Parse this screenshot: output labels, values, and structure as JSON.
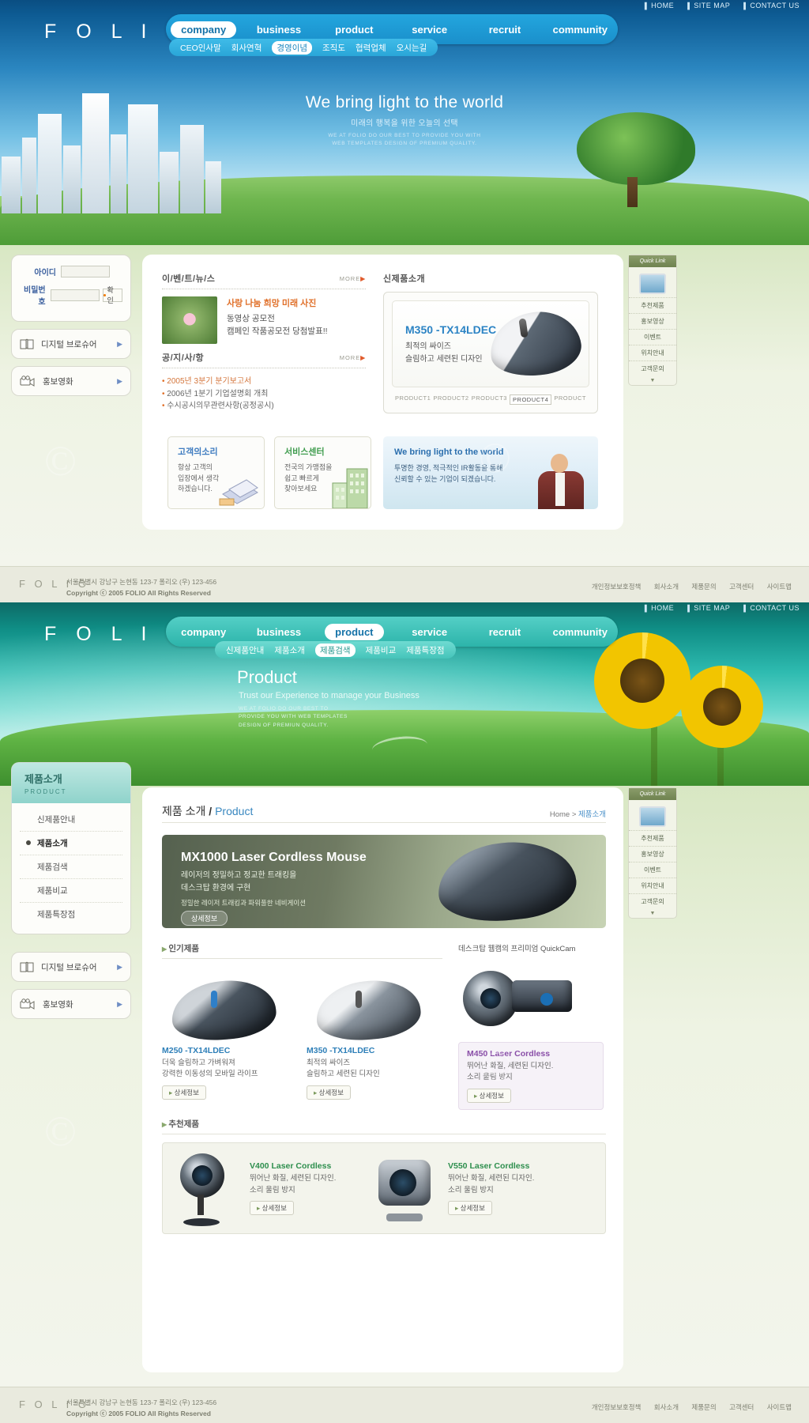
{
  "brand": {
    "logo": "F O L I O"
  },
  "top_links": [
    "HOME",
    "SITE MAP",
    "CONTACT US"
  ],
  "page1": {
    "nav": [
      {
        "label": "company",
        "active": true
      },
      {
        "label": "business",
        "active": false
      },
      {
        "label": "product",
        "active": false
      },
      {
        "label": "service",
        "active": false
      },
      {
        "label": "recruit",
        "active": false
      },
      {
        "label": "community",
        "active": false
      }
    ],
    "subnav": [
      {
        "label": "CEO인사말",
        "active": false
      },
      {
        "label": "회사연혁",
        "active": false
      },
      {
        "label": "경영이념",
        "active": true
      },
      {
        "label": "조직도",
        "active": false
      },
      {
        "label": "협력업체",
        "active": false
      },
      {
        "label": "오시는길",
        "active": false
      }
    ],
    "hero": {
      "title": "We bring light to the world",
      "subtitle": "미래의 행복을 위한 오늘의 선택",
      "body": "WE AT FOLIO DO OUR BEST TO PROVIDE YOU WITH\nWEB TEMPLATES DESIGN OF PREMIUM QUALITY."
    },
    "login": {
      "id_label": "아이디",
      "pw_label": "비밀번호",
      "id_value": "",
      "pw_value": "",
      "submit": "확 인"
    },
    "side_buttons": [
      {
        "label": "디지털 브로슈어",
        "icon": "book-icon"
      },
      {
        "label": "홍보영화",
        "icon": "video-camera-icon"
      }
    ],
    "events": {
      "title": "이/벤/트/뉴/스",
      "more": "MORE",
      "headline": "사랑 나눔 희망 미래 사진",
      "lines": [
        "동영상 공모전",
        "캠페인 작품공모전 당첨발표!!"
      ]
    },
    "notice": {
      "title": "공/지/사/항",
      "more": "MORE",
      "items": [
        {
          "text": "2005년 3분기 분기보고서",
          "highlight": true
        },
        {
          "text": "2006년 1분기 기업설명회 개최",
          "highlight": false
        },
        {
          "text": "수시공시의무관련사항(공정공시)",
          "highlight": false
        }
      ]
    },
    "new_product": {
      "title": "신제품소개",
      "name": "M350 -TX14LDEC",
      "lines": [
        "최적의 싸이즈",
        "슬림하고 세련된 디자인"
      ],
      "tabs": [
        {
          "label": "PRODUCT1",
          "active": false
        },
        {
          "label": "PRODUCT2",
          "active": false
        },
        {
          "label": "PRODUCT3",
          "active": false
        },
        {
          "label": "PRODUCT4",
          "active": true
        },
        {
          "label": "PRODUCT",
          "active": false
        }
      ]
    },
    "voice_box": {
      "title": "고객의소리",
      "text": "항상 고객의\n입장에서 생각\n하겠습니다."
    },
    "service_box": {
      "title": "서비스센터",
      "text": "전국의 가맹점을\n쉽고 빠르게\n찾아보세요"
    },
    "blue_banner": {
      "title": "We bring light to the world",
      "text": "투명한 경영, 적극적인 IR활동을 통해\n신뢰할 수 있는 기업이 되겠습니다."
    }
  },
  "quick_link": {
    "title": "Quick Link",
    "items": [
      "추천제품",
      "홍보영상",
      "이벤트",
      "위치안내",
      "고객문의"
    ],
    "more": "▼"
  },
  "footer": {
    "logo": "F O L I O",
    "address": "서울특별시 강남구 논현동 123-7 폴리오  (우) 123-456",
    "copyright": "Copyright ⓒ 2005 FOLIO All Rights Reserved",
    "links": [
      "개인정보보호정책",
      "회사소개",
      "제품문의",
      "고객센터",
      "사이트맵"
    ]
  },
  "page2": {
    "nav": [
      {
        "label": "company",
        "active": false
      },
      {
        "label": "business",
        "active": false
      },
      {
        "label": "product",
        "active": true
      },
      {
        "label": "service",
        "active": false
      },
      {
        "label": "recruit",
        "active": false
      },
      {
        "label": "community",
        "active": false
      }
    ],
    "subnav": [
      {
        "label": "신제품안내",
        "active": false
      },
      {
        "label": "제품소개",
        "active": false
      },
      {
        "label": "제품검색",
        "active": true
      },
      {
        "label": "제품비교",
        "active": false
      },
      {
        "label": "제품특장점",
        "active": false
      }
    ],
    "hero": {
      "title": "Product",
      "subtitle": "Trust our Experience to manage your Business",
      "body": "WE AT FOLIO DO OUR BEST TO\nPROVIDE YOU WITH WEB TEMPLATES\nDESIGN OF PREMIUN QUALITY."
    },
    "sidenav": {
      "kr": "제품소개",
      "en": "PRODUCT",
      "items": [
        {
          "label": "신제품안내",
          "active": false
        },
        {
          "label": "제품소개",
          "active": true
        },
        {
          "label": "제품검색",
          "active": false
        },
        {
          "label": "제품비교",
          "active": false
        },
        {
          "label": "제품특장점",
          "active": false
        }
      ]
    },
    "side_buttons": [
      {
        "label": "디지털 브로슈어",
        "icon": "book-icon"
      },
      {
        "label": "홍보영화",
        "icon": "video-camera-icon"
      }
    ],
    "page_title_kr": "제품 소개",
    "page_title_en": "Product",
    "breadcrumb": "Home",
    "breadcrumb_current": "제품소개",
    "promo": {
      "title": "MX1000 Laser Cordless Mouse",
      "lines": [
        "레이저의 정밀하고 정교한 트래킹을",
        "데스크탑 환경에 구현"
      ],
      "small": "정밀한 레이저 트래킹과 파워풀한 네비게이션",
      "button": "상세정보"
    },
    "popular_title": "인기제품",
    "popular": [
      {
        "name": "M250 -TX14LDEC",
        "desc": "더욱 슬림하고 가벼워져\n강력한 이동성의 모바일 라이프",
        "button": "상세정보"
      },
      {
        "name": "M350 -TX14LDEC",
        "desc": "최적의 싸이즈\n슬림하고 세련된 디자인",
        "button": "상세정보"
      }
    ],
    "quickcam": {
      "caption": "데스크탑 웹캠의 프리미엄  QuickCam",
      "name": "M450 Laser Cordless",
      "desc": "뛰어난 화질, 세련된 디자인.\n소리 울림 방지",
      "button": "상세정보"
    },
    "recommend_title": "추천제품",
    "recommend": [
      {
        "name": "V400 Laser Cordless",
        "desc": "뛰어난 화질, 세련된 디자인.\n소리 울림 방지",
        "button": "상세정보"
      },
      {
        "name": "V550 Laser Cordless",
        "desc": "뛰어난 화질, 세련된 디자인.\n소리 울림 방지",
        "button": "상세정보"
      }
    ]
  }
}
